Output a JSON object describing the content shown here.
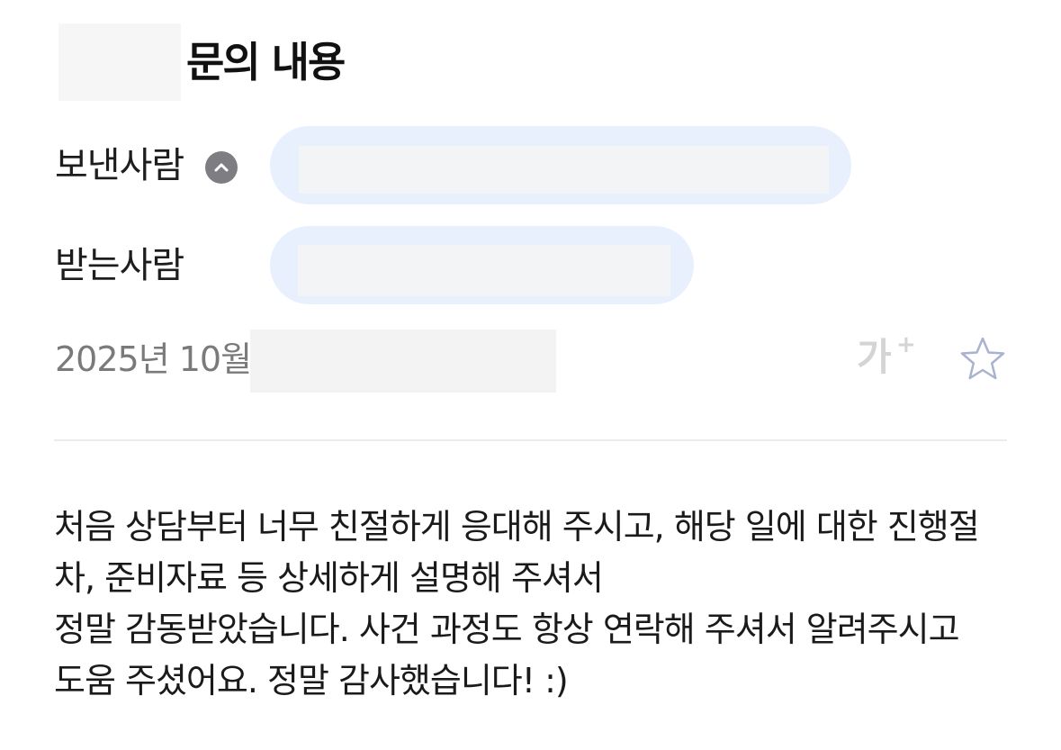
{
  "header": {
    "title": "문의 내용"
  },
  "sender": {
    "label": "보낸사람",
    "toggle_icon": "chevron-up-icon"
  },
  "recipient": {
    "label": "받는사람"
  },
  "meta": {
    "date_prefix": "2025년 10월",
    "font_size_label": "가",
    "font_size_plus": "+"
  },
  "message": {
    "lines": [
      "처음 상담부터 너무 친절하게 응대해 주시고, 해당 일에 대한 진행절",
      "차, 준비자료 등 상세하게 설명해 주셔서",
      "정말 감동받았습니다. 사건 과정도 항상 연락해 주셔서 알려주시고",
      "도움 주셨어요. 정말 감사했습니다! :)"
    ]
  },
  "colors": {
    "pill_background": "#e8f0fd",
    "toggle_background": "#7e7e82",
    "muted_text": "#7a7a7a",
    "star_outline": "#a9b3d0"
  }
}
